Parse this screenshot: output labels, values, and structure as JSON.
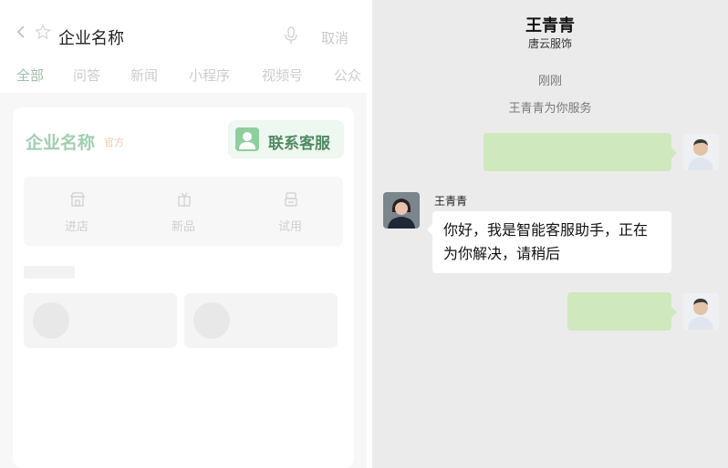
{
  "search": {
    "query": "企业名称",
    "cancel_label": "取消"
  },
  "tabs": [
    {
      "label": "全部"
    },
    {
      "label": "问答"
    },
    {
      "label": "新闻"
    },
    {
      "label": "小程序"
    },
    {
      "label": "视频号"
    },
    {
      "label": "公众"
    }
  ],
  "result_card": {
    "company_name": "企业名称",
    "badge": "官方",
    "contact_label": "联系客服",
    "actions": [
      {
        "label": "进店",
        "icon": "store-icon"
      },
      {
        "label": "新品",
        "icon": "gift-icon"
      },
      {
        "label": "试用",
        "icon": "trial-icon"
      }
    ]
  },
  "chat": {
    "contact_name": "王青青",
    "contact_org": "唐云服饰",
    "timestamp": "刚刚",
    "system_message": "王青青为你服务",
    "agent_name": "王青青",
    "agent_message": "你好，我是智能客服助手，正在为你解决，请稍后"
  },
  "colors": {
    "bubble_green": "#cfe8bd",
    "chat_bg": "#ebebeb",
    "accent_green": "#9fcfaf"
  }
}
